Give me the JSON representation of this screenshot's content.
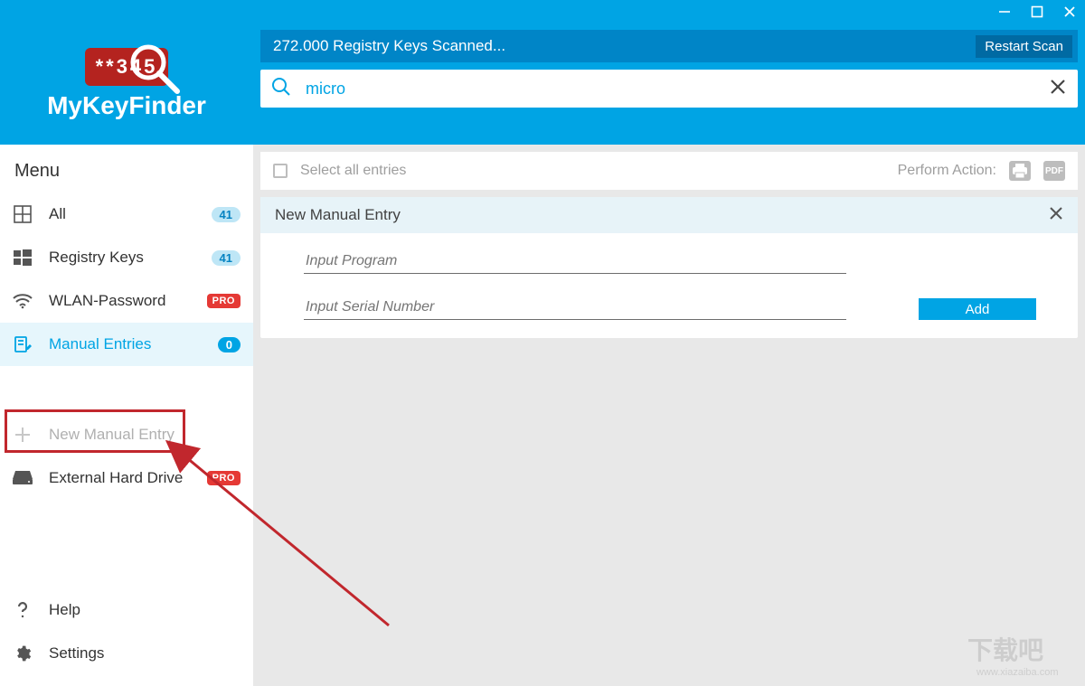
{
  "app": {
    "name": "MyKeyFinder",
    "logo_digits": "**345"
  },
  "window_controls": {
    "minimize": "—",
    "maximize": "□",
    "close": "✕"
  },
  "scan": {
    "status": "272.000 Registry Keys Scanned...",
    "restart_label": "Restart Scan"
  },
  "search": {
    "value": "micro",
    "placeholder": ""
  },
  "sidebar": {
    "menu_label": "Menu",
    "items": [
      {
        "icon": "grid-icon",
        "label": "All",
        "count": "41"
      },
      {
        "icon": "windows-icon",
        "label": "Registry Keys",
        "count": "41"
      },
      {
        "icon": "wifi-icon",
        "label": "WLAN-Password",
        "pro": "PRO"
      },
      {
        "icon": "manual-icon",
        "label": "Manual Entries",
        "count": "0",
        "active": true
      }
    ],
    "new_manual_entry": "New Manual Entry",
    "external_hd": {
      "label": "External Hard Drive",
      "pro": "PRO"
    },
    "help": "Help",
    "settings": "Settings"
  },
  "toolbar": {
    "select_all": "Select all entries",
    "perform_action": "Perform Action:"
  },
  "panel": {
    "title": "New Manual Entry",
    "program_placeholder": "Input Program",
    "serial_placeholder": "Input Serial Number",
    "add_label": "Add"
  },
  "watermark": "下载吧"
}
